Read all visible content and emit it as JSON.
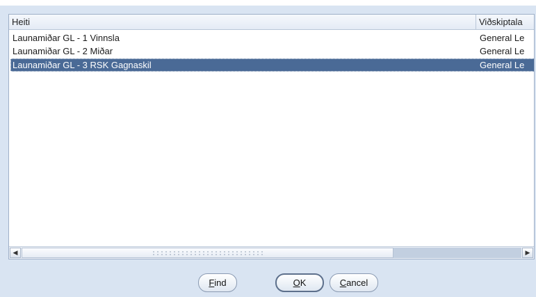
{
  "list": {
    "columns": [
      "Heiti",
      "Viðskiptala"
    ],
    "rows": [
      {
        "name": "Launamiðar GL - 1 Vinnsla",
        "ledger": "General Le"
      },
      {
        "name": "Launamiðar GL - 2 Miðar",
        "ledger": "General Le"
      },
      {
        "name": "Launamiðar GL - 3 RSK Gagnaskil",
        "ledger": "General Le"
      }
    ],
    "selected_row": 2
  },
  "buttons": {
    "find": {
      "mnemonic": "F",
      "rest": "ind"
    },
    "ok": {
      "mnemonic": "O",
      "rest": "K"
    },
    "cancel": {
      "mnemonic": "C",
      "rest": "ancel"
    }
  },
  "colors": {
    "selection": "#4a6a96",
    "dialog_background": "#d9e4f2"
  }
}
